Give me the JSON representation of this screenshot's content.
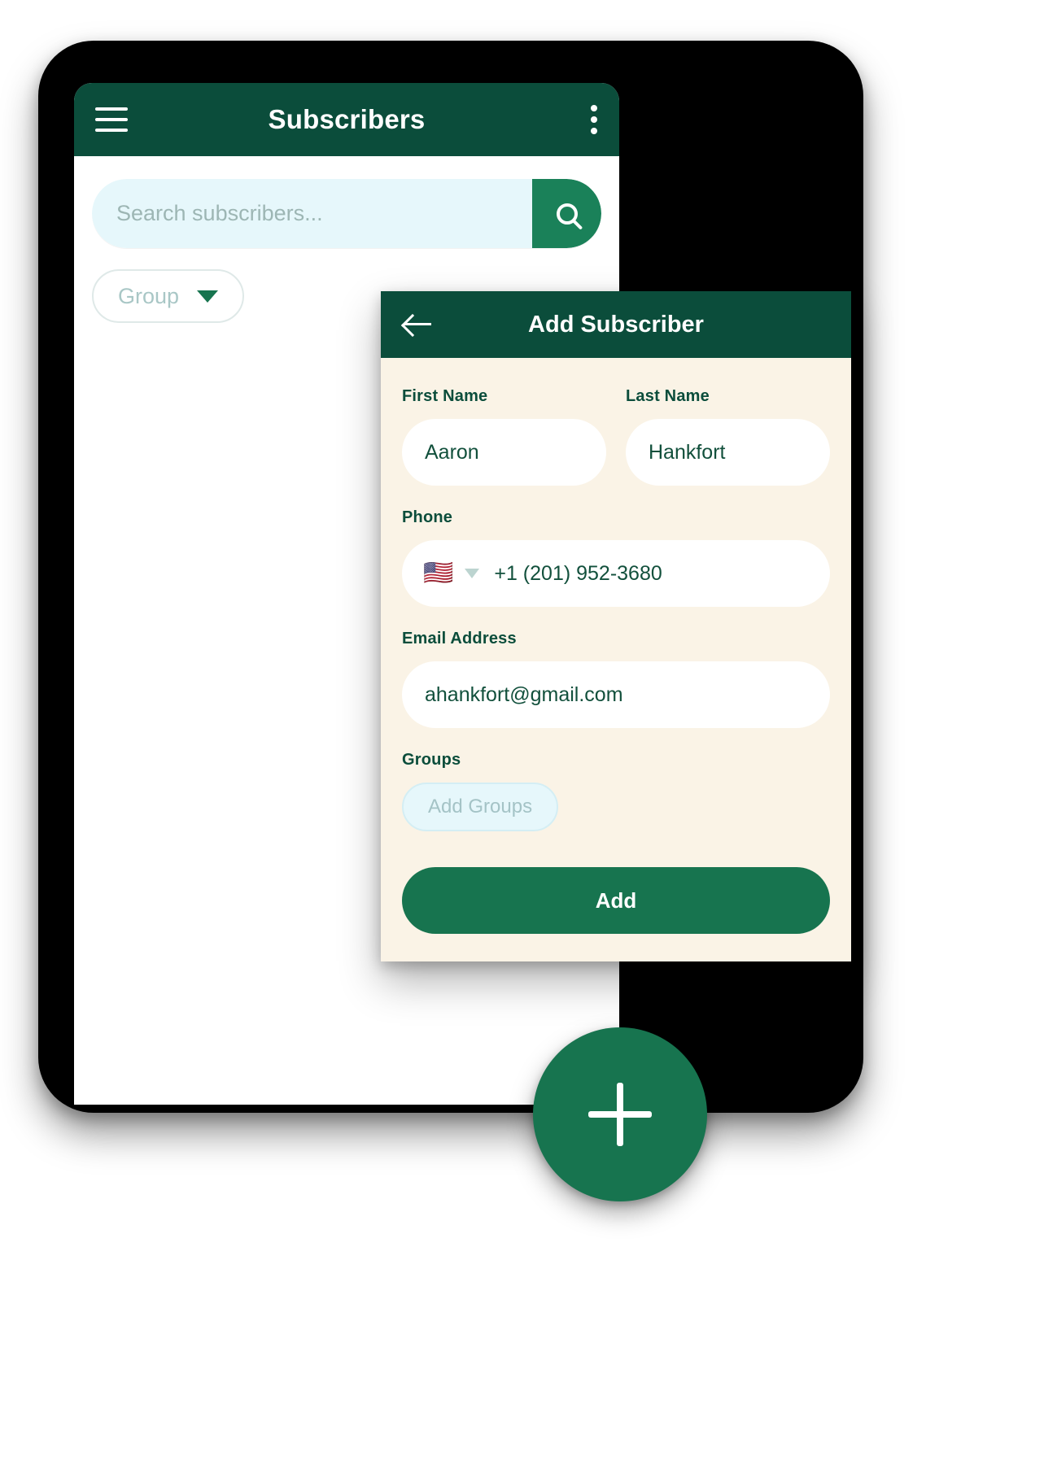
{
  "colors": {
    "brand_dark": "#0b4d3b",
    "brand_green": "#17744f",
    "search_button_green": "#1a8159",
    "dialog_bg": "#faf3e6",
    "chip_blue": "#e6f7fb",
    "text_green": "#12503c"
  },
  "phone": {
    "appbar": {
      "title": "Subscribers",
      "menu_icon": "hamburger-icon",
      "overflow_icon": "more-vertical-icon"
    },
    "search": {
      "placeholder": "Search subscribers...",
      "value": "",
      "button_icon": "search-icon"
    },
    "filter_chip": {
      "label": "Group",
      "caret_icon": "chevron-down-icon"
    },
    "fab": {
      "icon": "plus-icon",
      "label": "+"
    }
  },
  "dialog": {
    "title": "Add Subscriber",
    "back_icon": "arrow-left-icon",
    "fields": {
      "first_name": {
        "label": "First Name",
        "value": "Aaron",
        "placeholder": "First Name"
      },
      "last_name": {
        "label": "Last Name",
        "value": "Hankfort",
        "placeholder": "Last Name"
      },
      "phone": {
        "label": "Phone",
        "flag": "🇺🇸",
        "flag_icon": "us-flag-icon",
        "caret_icon": "chevron-down-icon",
        "country_code": "+1",
        "number": "(201) 952-3680",
        "display": "+1  (201) 952-3680"
      },
      "email": {
        "label": "Email Address",
        "value": "ahankfort@gmail.com",
        "placeholder": "Email Address"
      },
      "groups": {
        "label": "Groups",
        "add_chip_label": "Add Groups"
      }
    },
    "submit_label": "Add"
  }
}
